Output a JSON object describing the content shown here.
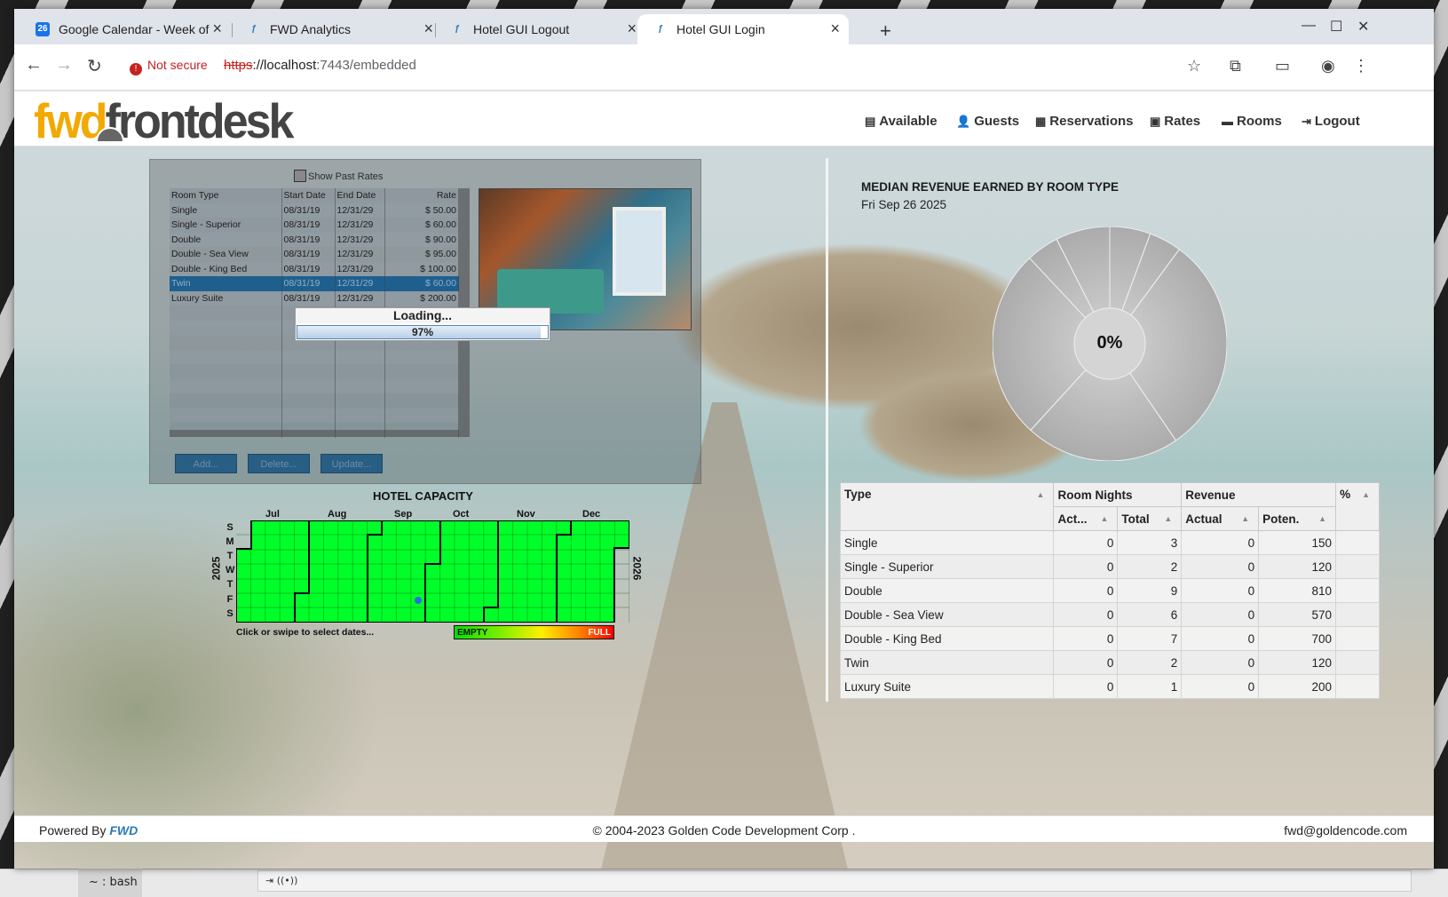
{
  "browser": {
    "tabs": [
      {
        "title": "Google Calendar - Week of",
        "favicon": "calendar-icon",
        "active": false
      },
      {
        "title": "FWD Analytics",
        "favicon": "fwd-icon",
        "active": false
      },
      {
        "title": "Hotel GUI Logout",
        "favicon": "fwd-icon",
        "active": false
      },
      {
        "title": "Hotel GUI Login",
        "favicon": "fwd-icon",
        "active": true
      }
    ],
    "calendar_favicon_text": "26",
    "security_label": "Not secure",
    "url_scheme": "https",
    "url_host": "://localhost",
    "url_rest": ":7443/embedded"
  },
  "app": {
    "logo_part1": "fwd",
    "logo_part2": "frontdesk",
    "nav": {
      "available": "Available",
      "guests": "Guests",
      "reservations": "Reservations",
      "rates": "Rates",
      "rooms": "Rooms",
      "logout": "Logout"
    }
  },
  "rates": {
    "show_past_label": "Show Past Rates",
    "columns": {
      "room_type": "Room Type",
      "start": "Start Date",
      "end": "End Date",
      "rate": "Rate"
    },
    "rows": [
      {
        "room_type": "Single",
        "start": "08/31/19",
        "end": "12/31/29",
        "rate": "$ 50.00"
      },
      {
        "room_type": "Single - Superior",
        "start": "08/31/19",
        "end": "12/31/29",
        "rate": "$ 60.00"
      },
      {
        "room_type": "Double",
        "start": "08/31/19",
        "end": "12/31/29",
        "rate": "$ 90.00"
      },
      {
        "room_type": "Double - Sea View",
        "start": "08/31/19",
        "end": "12/31/29",
        "rate": "$ 95.00"
      },
      {
        "room_type": "Double - King Bed",
        "start": "08/31/19",
        "end": "12/31/29",
        "rate": "$ 100.00"
      },
      {
        "room_type": "Twin",
        "start": "08/31/19",
        "end": "12/31/29",
        "rate": "$ 60.00"
      },
      {
        "room_type": "Luxury Suite",
        "start": "08/31/19",
        "end": "12/31/29",
        "rate": "$ 200.00"
      }
    ],
    "selected_index": 5,
    "buttons": {
      "add": "Add...",
      "delete": "Delete...",
      "update": "Update..."
    }
  },
  "loading": {
    "label": "Loading...",
    "percent_text": "97%",
    "progress": 0.97
  },
  "capacity": {
    "title": "HOTEL CAPACITY",
    "months": [
      "Jul",
      "Aug",
      "Sep",
      "Oct",
      "Nov",
      "Dec"
    ],
    "days": [
      "S",
      "M",
      "T",
      "W",
      "T",
      "F",
      "S"
    ],
    "year_start": "2025",
    "year_end": "2026",
    "hint": "Click or swipe to select dates...",
    "legend_empty": "EMPTY",
    "legend_full": "FULL",
    "fill_color": "#00ff2a"
  },
  "revenue_chart": {
    "title": "MEDIAN REVENUE EARNED BY ROOM TYPE",
    "date": "Fri Sep 26 2025",
    "center_label": "0%"
  },
  "chart_data": {
    "type": "pie",
    "title": "MEDIAN REVENUE EARNED BY ROOM TYPE",
    "subtitle": "Fri Sep 26 2025",
    "categories": [
      "Single",
      "Single - Superior",
      "Double",
      "Double - Sea View",
      "Double - King Bed",
      "Twin",
      "Luxury Suite"
    ],
    "values": [
      150,
      120,
      810,
      570,
      700,
      120,
      200
    ],
    "center_label": "0%"
  },
  "revenue_table": {
    "headers": {
      "type": "Type",
      "room_nights": "Room Nights",
      "revenue": "Revenue",
      "pct": "%",
      "actual_nights": "Act...",
      "total": "Total",
      "actual": "Actual",
      "potential": "Poten."
    },
    "rows": [
      {
        "type": "Single",
        "act": "0",
        "total": "3",
        "actual": "0",
        "potential": "150",
        "pct": ""
      },
      {
        "type": "Single - Superior",
        "act": "0",
        "total": "2",
        "actual": "0",
        "potential": "120",
        "pct": ""
      },
      {
        "type": "Double",
        "act": "0",
        "total": "9",
        "actual": "0",
        "potential": "810",
        "pct": ""
      },
      {
        "type": "Double - Sea View",
        "act": "0",
        "total": "6",
        "actual": "0",
        "potential": "570",
        "pct": ""
      },
      {
        "type": "Double - King Bed",
        "act": "0",
        "total": "7",
        "actual": "0",
        "potential": "700",
        "pct": ""
      },
      {
        "type": "Twin",
        "act": "0",
        "total": "2",
        "actual": "0",
        "potential": "120",
        "pct": ""
      },
      {
        "type": "Luxury Suite",
        "act": "0",
        "total": "1",
        "actual": "0",
        "potential": "200",
        "pct": ""
      }
    ]
  },
  "footer": {
    "powered_by": "Powered By",
    "brand": "FWD",
    "copyright": "© 2004-2023 Golden Code Development Corp .",
    "email": "fwd@goldencode.com"
  },
  "taskbar": {
    "terminal": "~ : bash",
    "strip_icons": "⇥ ((•))"
  }
}
